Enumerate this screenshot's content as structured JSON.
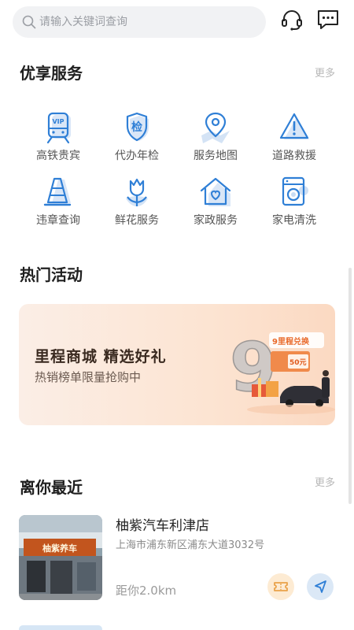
{
  "search": {
    "placeholder": "请输入关键词查询"
  },
  "header": {
    "icons": [
      "headset-icon",
      "message-icon"
    ]
  },
  "services": {
    "title": "优享服务",
    "more": "更多",
    "items": [
      {
        "label": "高铁贵宾",
        "icon": "vip-train-icon"
      },
      {
        "label": "代办年检",
        "icon": "inspection-shield-icon"
      },
      {
        "label": "服务地图",
        "icon": "map-pin-icon"
      },
      {
        "label": "道路救援",
        "icon": "warning-triangle-icon"
      },
      {
        "label": "违章查询",
        "icon": "traffic-cone-icon"
      },
      {
        "label": "鲜花服务",
        "icon": "flower-icon"
      },
      {
        "label": "家政服务",
        "icon": "home-heart-icon"
      },
      {
        "label": "家电清洗",
        "icon": "washing-machine-icon"
      }
    ],
    "icon_color": "#2f7fd6"
  },
  "activities": {
    "title": "热门活动",
    "banner": {
      "title": "里程商城  精选好礼",
      "subtitle": "热销榜单限量抢购中",
      "art_tag": "9里程兑换",
      "art_coupon": "50元"
    }
  },
  "nearby": {
    "title": "离你最近",
    "more": "更多",
    "stores": [
      {
        "name": "柚紫汽车利津店",
        "address": "上海市浦东新区浦东大道3032号",
        "distance": "距你2.0km",
        "sign": "柚紫养车"
      }
    ]
  }
}
